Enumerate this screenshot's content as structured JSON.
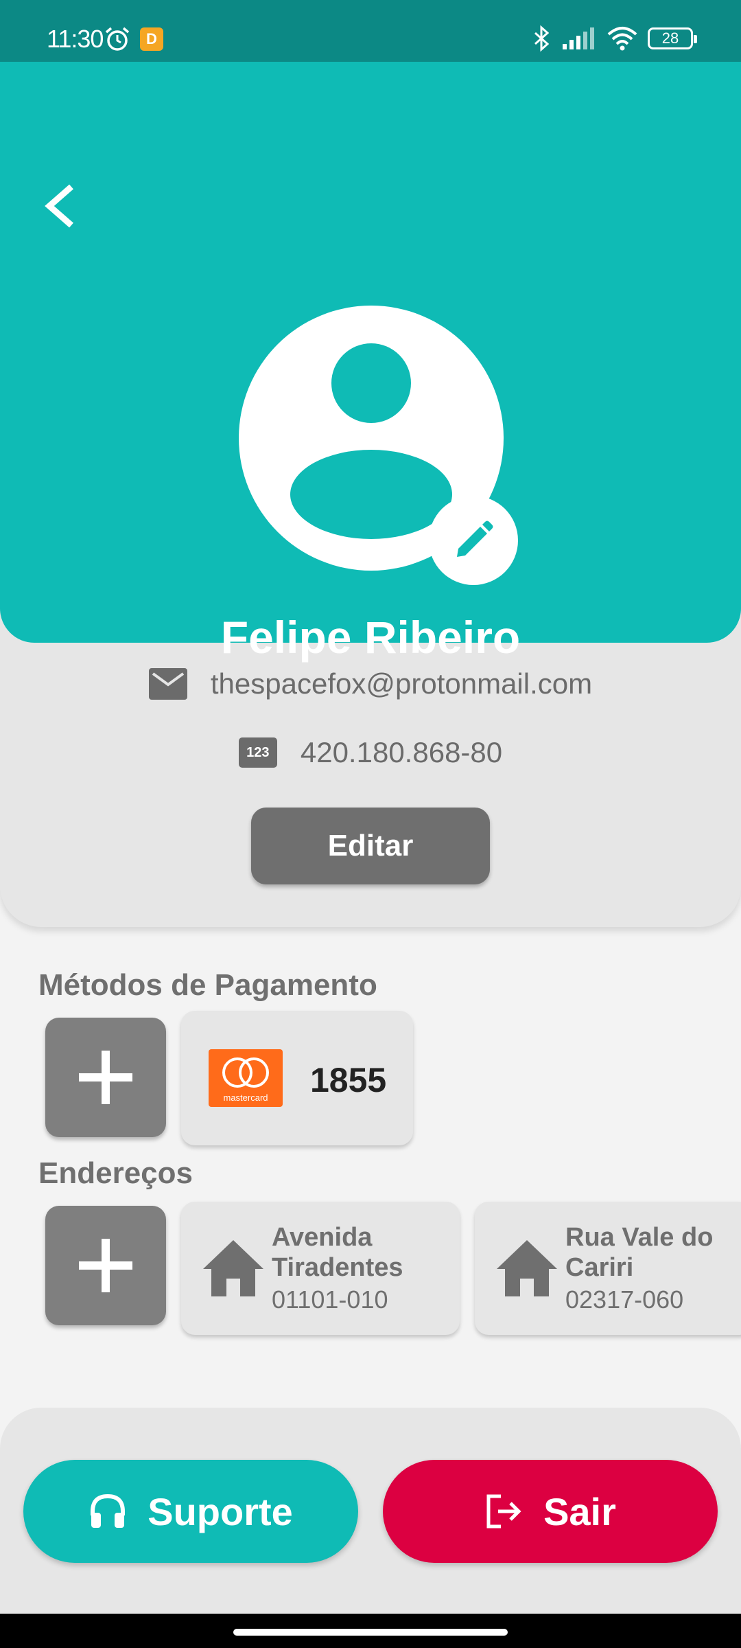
{
  "status_bar": {
    "time": "11:30",
    "app_badge": "D",
    "battery": "28"
  },
  "profile": {
    "name": "Felipe Ribeiro",
    "email": "thespacefox@protonmail.com",
    "document_badge": "123",
    "document": "420.180.868-80",
    "edit_label": "Editar"
  },
  "payment": {
    "title": "Métodos de Pagamento",
    "cards": [
      {
        "brand": "mastercard",
        "last_digits": "1855"
      }
    ]
  },
  "addresses": {
    "title": "Endereços",
    "items": [
      {
        "street": "Avenida Tiradentes",
        "zip": "01101-010"
      },
      {
        "street": "Rua Vale do Cariri",
        "zip": "02317-060"
      }
    ]
  },
  "actions": {
    "support_label": "Suporte",
    "logout_label": "Sair"
  },
  "colors": {
    "primary": "#0fbbb5",
    "status_bar": "#0c8985",
    "danger": "#dc0041",
    "grey_button": "#6f6f6f"
  },
  "icons": {
    "back": "chevron-left-icon",
    "avatar": "person-icon",
    "edit_photo": "pencil-icon",
    "email": "mail-icon",
    "document": "id-number-icon",
    "add": "plus-icon",
    "address": "house-icon",
    "support": "headset-icon",
    "logout": "logout-icon"
  }
}
